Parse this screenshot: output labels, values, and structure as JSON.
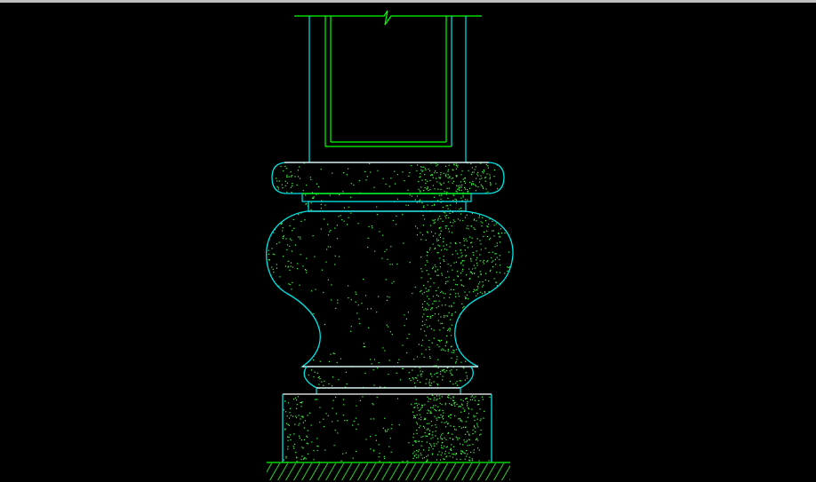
{
  "canvas": {
    "background": "#000000",
    "frame_strip_color": "#c0c0c0"
  },
  "colors": {
    "outline": "#00e5e5",
    "inner_line": "#00ff00",
    "section_line": "#ffffff",
    "stipple": "#40ff40",
    "hatch": "#33cc33"
  },
  "drawing": {
    "subject": "column-base-elevation",
    "parts": [
      "pedestal-shaft",
      "break-line",
      "upper-torus-molding",
      "upper-fillet",
      "vase-body",
      "lower-collar",
      "plinth-block",
      "ground-hatch"
    ],
    "stipple_density": "medium"
  }
}
